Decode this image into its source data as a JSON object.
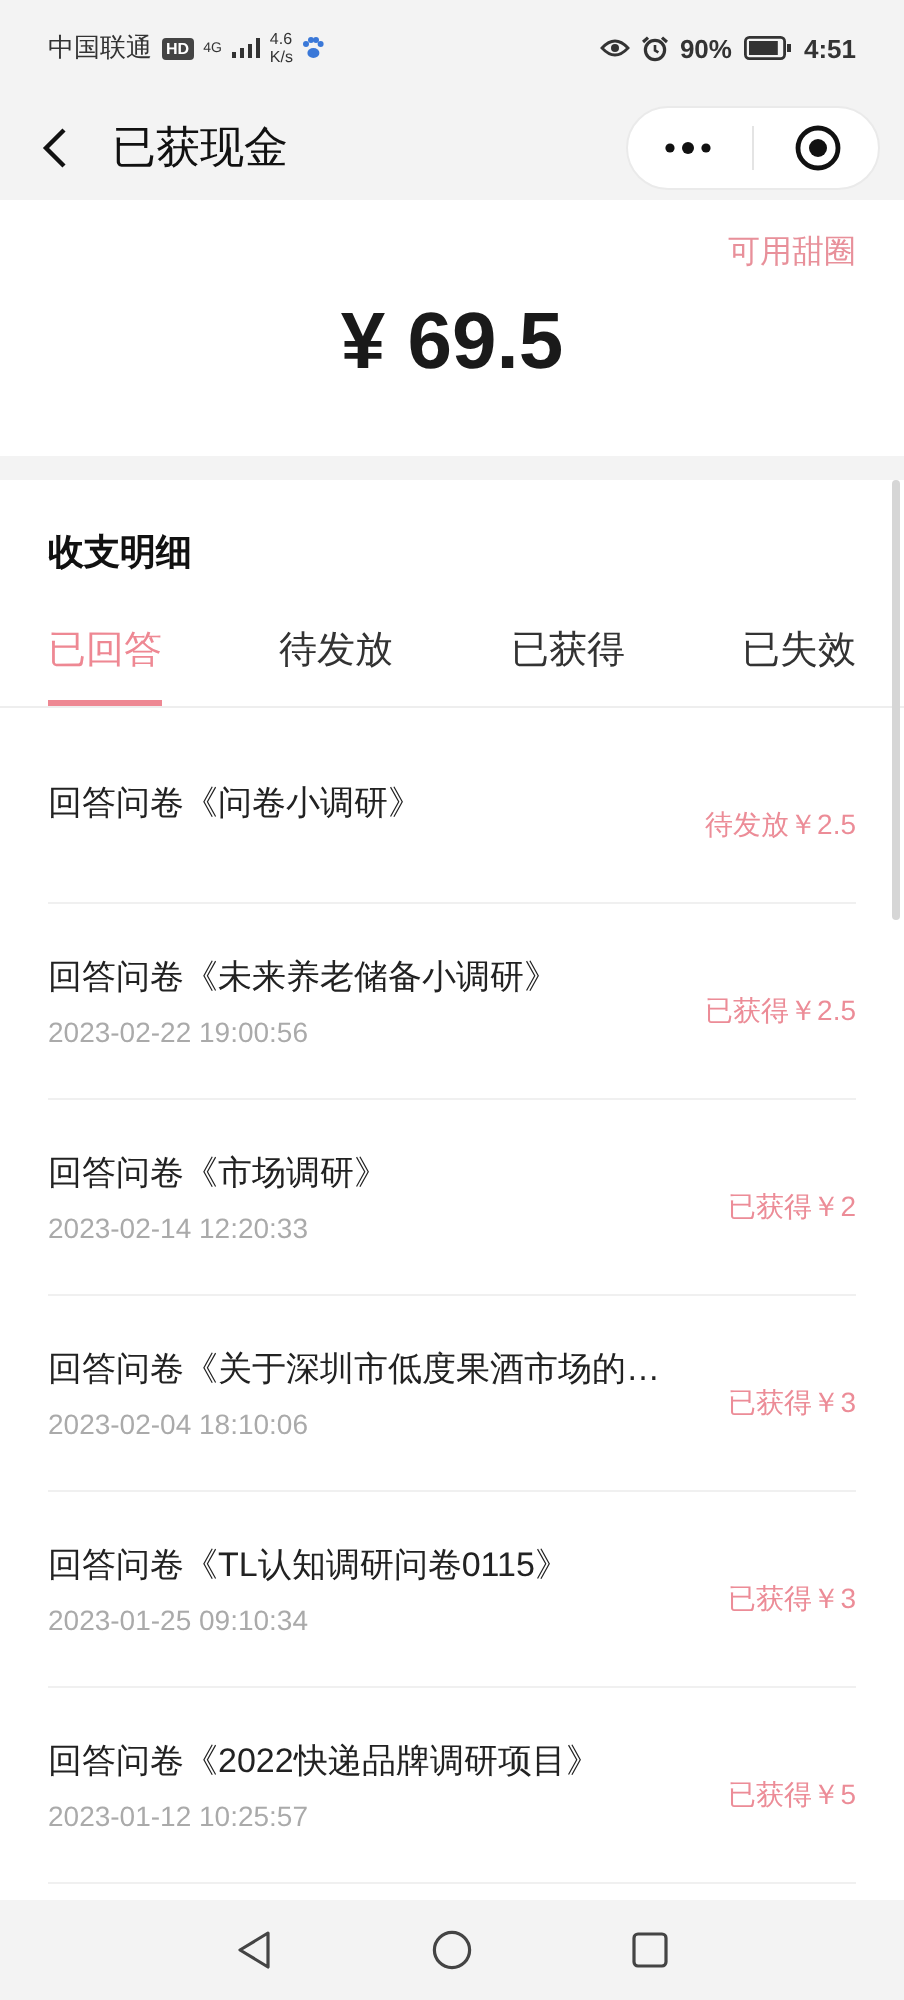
{
  "status_bar": {
    "carrier": "中国联通",
    "hd": "HD",
    "network": "4G",
    "speed_value": "4.6",
    "speed_unit": "K/s",
    "battery_percent": "90%",
    "time": "4:51"
  },
  "nav": {
    "title": "已获现金"
  },
  "balance": {
    "link": "可用甜圈",
    "amount": "¥ 69.5"
  },
  "section": {
    "title": "收支明细"
  },
  "tabs": [
    {
      "label": "已回答",
      "selected": true
    },
    {
      "label": "待发放",
      "selected": false
    },
    {
      "label": "已获得",
      "selected": false
    },
    {
      "label": "已失效",
      "selected": false
    }
  ],
  "records": [
    {
      "title": "回答问卷《问卷小调研》",
      "amount": "待发放￥2.5"
    },
    {
      "title": "回答问卷《未来养老储备小调研》",
      "time": "2023-02-22 19:00:56",
      "amount": "已获得￥2.5"
    },
    {
      "title": "回答问卷《市场调研》",
      "time": "2023-02-14 12:20:33",
      "amount": "已获得￥2"
    },
    {
      "title": "回答问卷《关于深圳市低度果酒市场的…",
      "time": "2023-02-04 18:10:06",
      "amount": "已获得￥3"
    },
    {
      "title": "回答问卷《TL认知调研问卷0115》",
      "time": "2023-01-25 09:10:34",
      "amount": "已获得￥3"
    },
    {
      "title": "回答问卷《2022快递品牌调研项目》",
      "time": "2023-01-12 10:25:57",
      "amount": "已获得￥5"
    }
  ]
}
